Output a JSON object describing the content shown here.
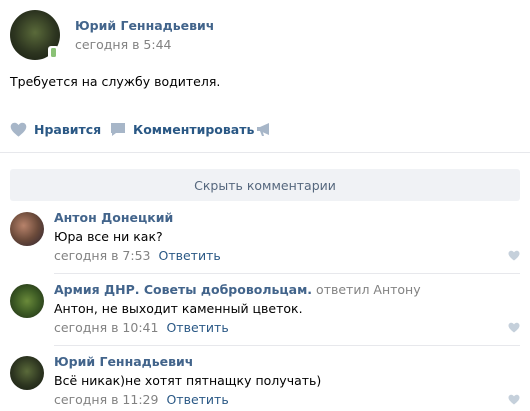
{
  "post": {
    "author": "Юрий Геннадьевич",
    "time": "сегодня в 5:44",
    "text": "Требуется на службу водителя.",
    "avatar_icon": "user-photo"
  },
  "actions": {
    "like_label": "Нравится",
    "comment_label": "Комментировать",
    "share_icon": "megaphone-icon"
  },
  "comments_toggle": "Скрыть комментарии",
  "comments": [
    {
      "author": "Антон Донецкий",
      "reply_to": "",
      "text": "Юра все ни как?",
      "time": "сегодня в 7:53",
      "reply_label": "Ответить"
    },
    {
      "author": "Армия ДНР. Советы добровольцам.",
      "reply_to": "ответил Антону",
      "text": "Антон, не выходит каменный цветок.",
      "time": "сегодня в 10:41",
      "reply_label": "Ответить"
    },
    {
      "author": "Юрий Геннадьевич",
      "reply_to": "",
      "text": "Всё никак)не хотят пятнащку получать)",
      "time": "сегодня в 11:29",
      "reply_label": "Ответить"
    }
  ],
  "colors": {
    "link": "#2a5885",
    "author": "#42648b",
    "muted": "#828282",
    "icon": "#a7b6c8",
    "toggle_bg": "#f0f2f5"
  }
}
